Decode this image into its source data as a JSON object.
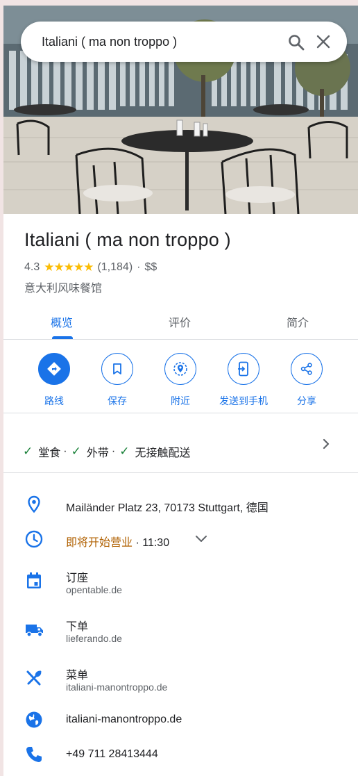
{
  "search": {
    "query": "Italiani ( ma non troppo )"
  },
  "place": {
    "name": "Italiani ( ma non troppo )",
    "rating": "4.3",
    "stars": "★★★★★",
    "review_count": "(1,184)",
    "separator": "·",
    "price": "$$",
    "category": "意大利风味餐馆"
  },
  "tabs": [
    {
      "label": "概览"
    },
    {
      "label": "评价"
    },
    {
      "label": "简介"
    }
  ],
  "actions": [
    {
      "label": "路线",
      "icon": "directions-icon"
    },
    {
      "label": "保存",
      "icon": "bookmark-icon"
    },
    {
      "label": "附近",
      "icon": "nearby-icon"
    },
    {
      "label": "发送到手机",
      "icon": "send-to-phone-icon"
    },
    {
      "label": "分享",
      "icon": "share-icon"
    }
  ],
  "services": [
    {
      "label": "堂食"
    },
    {
      "label": "外带"
    },
    {
      "label": "无接触配送"
    }
  ],
  "service_separator": "·",
  "check_glyph": "✓",
  "info": {
    "address": "Mailänder Platz 23, 70173 Stuttgart, 德国",
    "hours_status": "即将开始营业",
    "hours_time": " · 11:30",
    "reserve_label": "订座",
    "reserve_site": "opentable.de",
    "order_label": "下单",
    "order_site": "lieferando.de",
    "menu_label": "菜单",
    "menu_site": "italiani-manontroppo.de",
    "website": "italiani-manontroppo.de",
    "phone": "+49 711 28413444"
  },
  "colors": {
    "accent": "#1a73e8",
    "star": "#fbbc04",
    "check": "#188038",
    "hours_warning": "#b06000"
  }
}
